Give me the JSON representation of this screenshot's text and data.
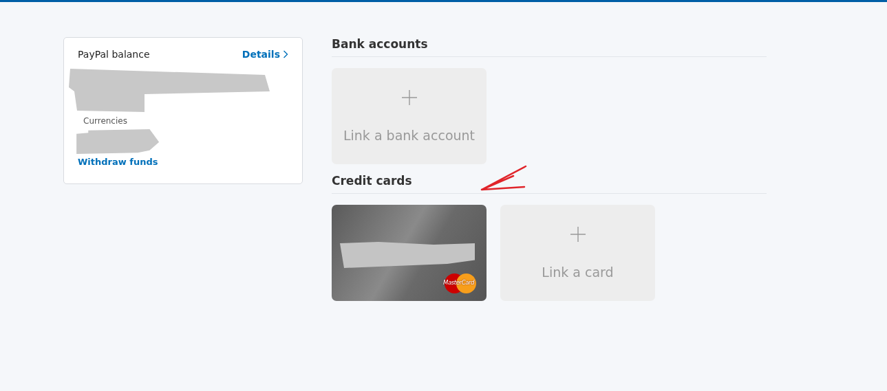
{
  "balance_card": {
    "title": "PayPal balance",
    "details_link": "Details",
    "currencies_label": "Currencies",
    "withdraw_link": "Withdraw funds"
  },
  "bank_accounts": {
    "heading": "Bank accounts",
    "add_tile": {
      "label": "Link a bank account"
    }
  },
  "credit_cards": {
    "heading": "Credit cards",
    "cards": [
      {
        "brand": "MasterCard",
        "kind": "mastercard"
      }
    ],
    "add_tile": {
      "label": "Link a card"
    }
  }
}
